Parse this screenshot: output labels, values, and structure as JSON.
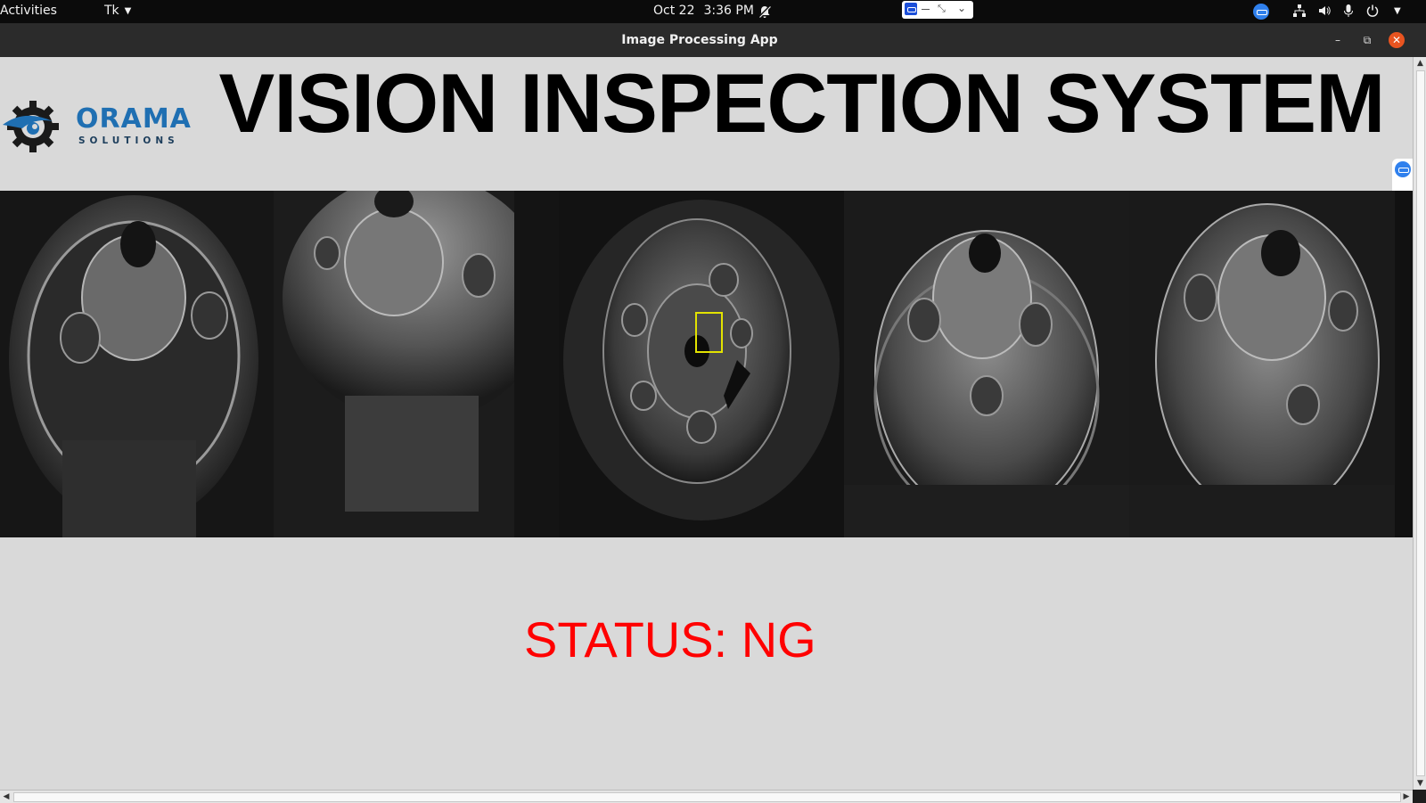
{
  "topbar": {
    "activities": "Activities",
    "app_menu": "Tk",
    "date": "Oct 22",
    "time": "3:36 PM"
  },
  "window": {
    "title": "Image Processing App"
  },
  "app": {
    "logo": {
      "name": "ORAMA",
      "subtitle": "SOLUTIONS"
    },
    "title": "VISION INSPECTION SYSTEM",
    "status": "STATUS: NG",
    "colors": {
      "status": "#ff0000",
      "logo_primary": "#1f6fb2",
      "defect_box": "#e3e300"
    },
    "camera_views": [
      {
        "name": "camera-view-1"
      },
      {
        "name": "camera-view-2"
      },
      {
        "name": "camera-view-3",
        "defect_marker": true
      },
      {
        "name": "camera-view-4"
      },
      {
        "name": "camera-view-5"
      }
    ]
  }
}
